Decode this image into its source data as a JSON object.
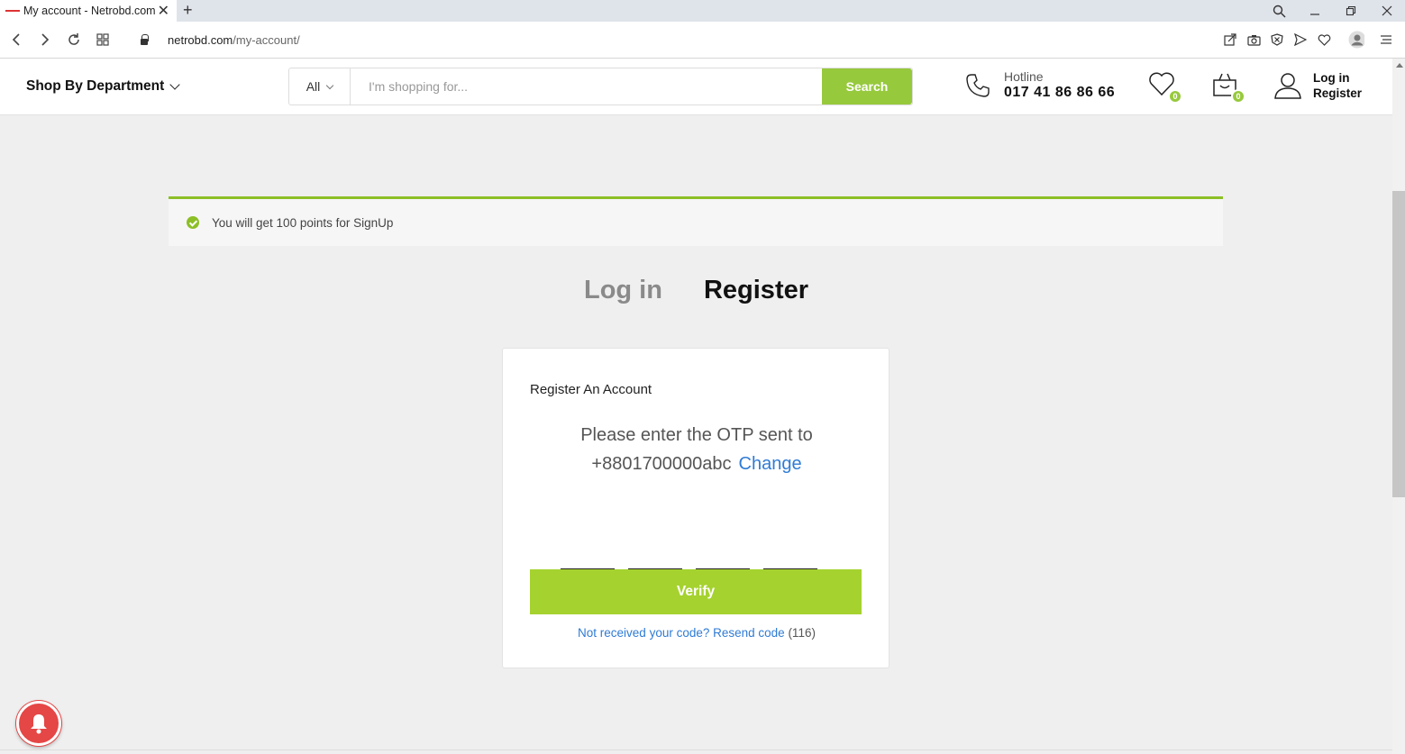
{
  "browser": {
    "tab_title": "My account - Netrobd.com",
    "url_host": "netrobd.com",
    "url_path": "/my-account/"
  },
  "header": {
    "shop_by_department": "Shop By Department",
    "search_category": "All",
    "search_placeholder": "I'm shopping for...",
    "search_button": "Search",
    "hotline_label": "Hotline",
    "hotline_number": "017 41 86 86 66",
    "wishlist_count": "0",
    "cart_count": "0",
    "login_label": "Log in",
    "register_label": "Register"
  },
  "notice": {
    "text": "You will get 100 points for SignUp"
  },
  "auth_tabs": {
    "login": "Log in",
    "register": "Register"
  },
  "card": {
    "title": "Register An Account",
    "otp_message": "Please enter the OTP sent to",
    "phone": "+8801700000abc",
    "change_link": "Change",
    "verify_button": "Verify",
    "resend_text": "Not received your code? Resend code",
    "resend_timer": "(116)"
  },
  "colors": {
    "accent_green": "#97c93d",
    "verify_green": "#a5d22f",
    "link_blue": "#2f7bd5",
    "bell_red": "#e54646"
  }
}
